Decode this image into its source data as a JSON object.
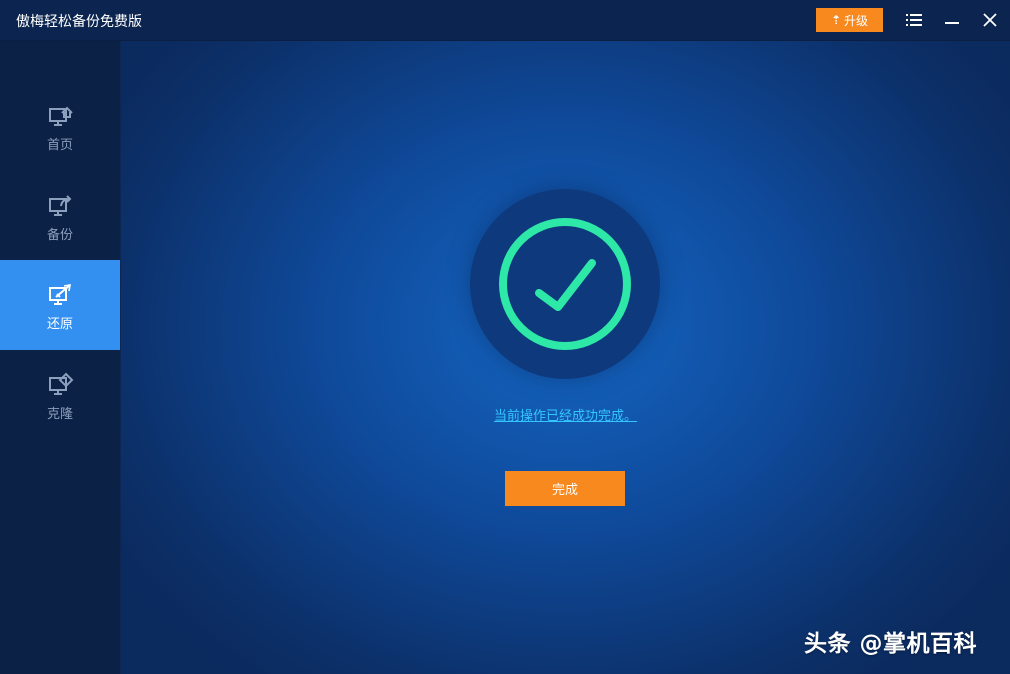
{
  "window": {
    "title": "傲梅轻松备份免费版",
    "upgrade_label": "升级"
  },
  "sidebar": {
    "items": [
      {
        "label": "首页",
        "icon": "home-monitor-icon",
        "active": false
      },
      {
        "label": "备份",
        "icon": "backup-monitor-icon",
        "active": false
      },
      {
        "label": "还原",
        "icon": "restore-monitor-icon",
        "active": true
      },
      {
        "label": "克隆",
        "icon": "clone-monitor-icon",
        "active": false
      }
    ]
  },
  "main": {
    "status_text": "当前操作已经成功完成。",
    "done_label": "完成"
  },
  "watermark": "头条 @掌机百科",
  "colors": {
    "accent_orange": "#f7891f",
    "active_nav": "#3390f0",
    "check_green": "#2ee8a8",
    "link_blue": "#34c6ff"
  }
}
